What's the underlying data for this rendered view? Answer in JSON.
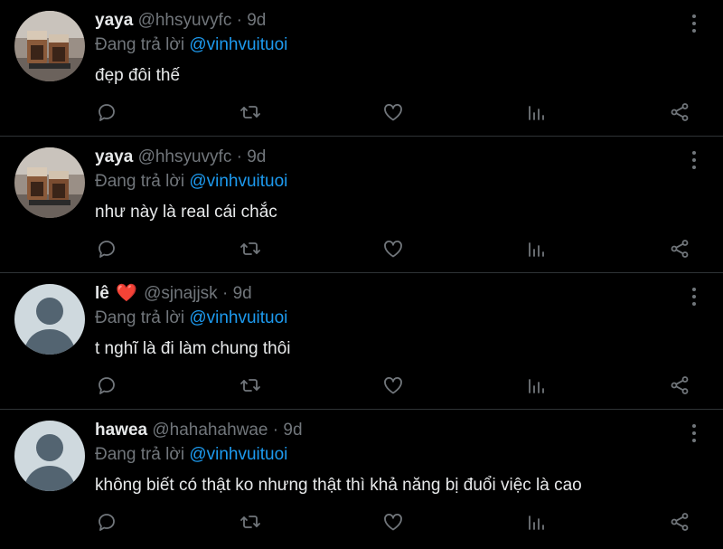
{
  "colors": {
    "background": "#000000",
    "text": "#e7e9ea",
    "muted": "#71767b",
    "mention": "#1d9bf0",
    "heart": "#f0254d",
    "divider": "#2f3336"
  },
  "icons": {
    "more": "vertical-ellipsis",
    "reply": "speech-bubble",
    "retweet": "retweet-arrows",
    "like": "heart-outline",
    "views": "bar-chart",
    "share": "share-nodes"
  },
  "tweets": [
    {
      "name": "yaya",
      "name_emoji": "",
      "handle": "@hhsyuvyfc",
      "separator": "·",
      "time": "9d",
      "reply_prefix": "Đang trả lời",
      "reply_to": "@vinhvuituoi",
      "text": "đẹp đôi thế",
      "avatar": "coffee-cups-photo"
    },
    {
      "name": "yaya",
      "name_emoji": "",
      "handle": "@hhsyuvyfc",
      "separator": "·",
      "time": "9d",
      "reply_prefix": "Đang trả lời",
      "reply_to": "@vinhvuituoi",
      "text": "như này là real cái chắc",
      "avatar": "coffee-cups-photo"
    },
    {
      "name": "lê",
      "name_emoji": "❤️",
      "handle": "@sjnajjsk",
      "separator": "·",
      "time": "9d",
      "reply_prefix": "Đang trả lời",
      "reply_to": "@vinhvuituoi",
      "text": "t nghĩ là đi làm chung thôi",
      "avatar": "default-profile"
    },
    {
      "name": "hawea",
      "name_emoji": "",
      "handle": "@hahahahwae",
      "separator": "·",
      "time": "9d",
      "reply_prefix": "Đang trả lời",
      "reply_to": "@vinhvuituoi",
      "text": "không biết có thật ko nhưng thật thì khả năng bị đuổi việc là cao",
      "avatar": "default-profile"
    }
  ]
}
